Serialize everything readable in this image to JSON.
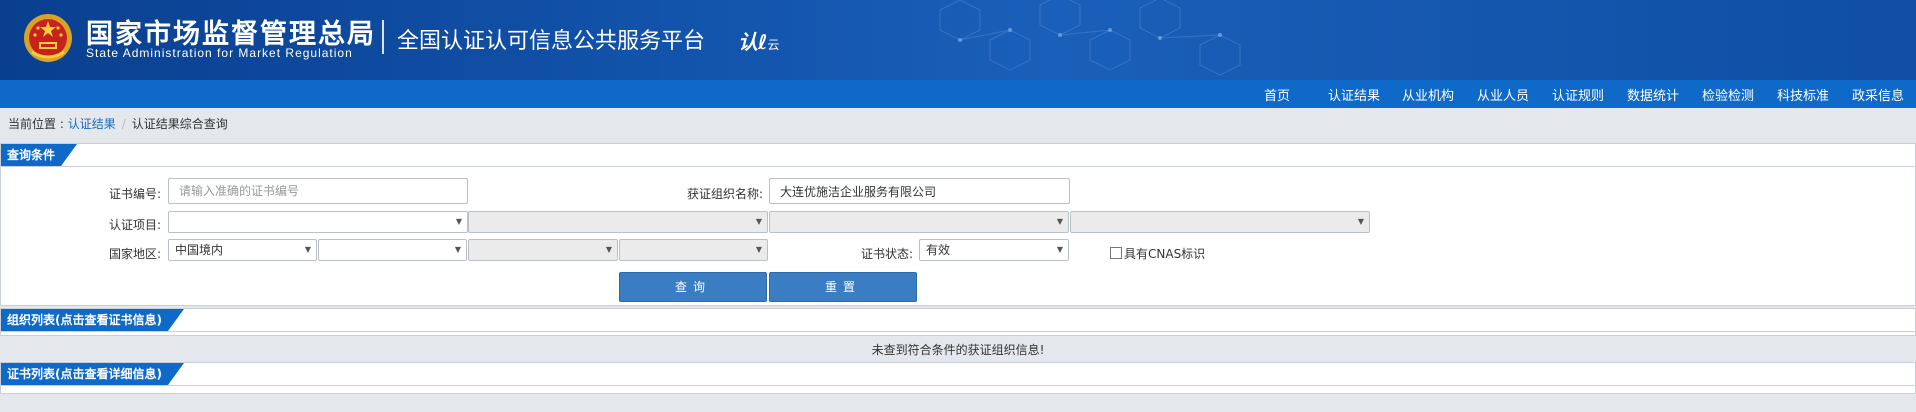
{
  "header": {
    "agency_cn": "国家市场监督管理总局",
    "agency_en": "State Administration  for  Market Regulation",
    "platform": "全国认证认可信息公共服务平台",
    "logo_text": "认",
    "logo_sub": "云"
  },
  "nav": [
    "首页",
    "认证结果",
    "从业机构",
    "从业人员",
    "认证规则",
    "数据统计",
    "检验检测",
    "科技标准",
    "政采信息"
  ],
  "breadcrumb": {
    "prefix": "当前位置 : ",
    "link": "认证结果",
    "current": "认证结果综合查询"
  },
  "query_panel": {
    "tab": "查询条件",
    "cert_no_label": "证书编号:",
    "cert_no_placeholder": "请输入准确的证书编号",
    "org_name_label": "获证组织名称:",
    "org_name_value": "大连优施洁企业服务有限公司",
    "project_label": "认证项目:",
    "region_label": "国家地区:",
    "region_value": "中国境内",
    "status_label": "证书状态:",
    "status_value": "有效",
    "cnas_label": "具有CNAS标识",
    "search_button": "查询",
    "reset_button": "重置"
  },
  "org_panel": {
    "tab": "组织列表(点击查看证书信息)",
    "empty_message": "未查到符合条件的获证组织信息!"
  },
  "cert_panel": {
    "tab": "证书列表(点击查看详细信息)"
  }
}
